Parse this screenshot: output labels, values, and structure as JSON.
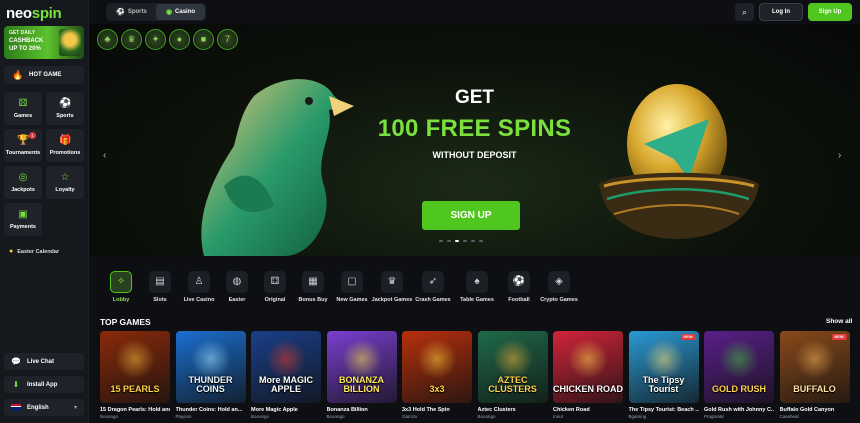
{
  "brand": {
    "logo_text_a": "neo",
    "logo_text_b": "spin"
  },
  "promo": {
    "line1": "GET DAILY",
    "line2": "CASHBACK",
    "line3": "UP TO 20%"
  },
  "sidebar": {
    "hot_game_label": "HOT GAME",
    "items": [
      {
        "label": "Games",
        "icon": "dice-icon"
      },
      {
        "label": "Sports",
        "icon": "soccer-ball-icon"
      },
      {
        "label": "Tournaments",
        "icon": "trophy-icon",
        "badge": "1"
      },
      {
        "label": "Promotions",
        "icon": "gift-icon"
      },
      {
        "label": "Jackpots",
        "icon": "coins-icon"
      },
      {
        "label": "Loyalty",
        "icon": "star-icon"
      },
      {
        "label": "Payments",
        "icon": "wallet-icon"
      }
    ],
    "easter_label": "Easter Calendar",
    "live_chat_label": "Live Chat",
    "install_app_label": "Install App",
    "language_label": "English"
  },
  "topbar": {
    "tab_sports": "Sports",
    "tab_casino": "Casino",
    "active_tab": "Casino",
    "login_label": "Log In",
    "signup_label": "Sign Up"
  },
  "hero": {
    "line1": "GET",
    "line2": "100 FREE SPINS",
    "line3": "WITHOUT DEPOSIT",
    "cta": "SIGN UP",
    "slide_count": 6,
    "active_slide": 3
  },
  "categories": [
    {
      "label": "Lobby",
      "icon": "stars-icon",
      "active": true
    },
    {
      "label": "Slots",
      "icon": "slot-machine-icon"
    },
    {
      "label": "Live Casino",
      "icon": "dealer-icon"
    },
    {
      "label": "Easter",
      "icon": "egg-icon"
    },
    {
      "label": "Original",
      "icon": "dice-icon"
    },
    {
      "label": "Bonus Buy",
      "icon": "gift-box-icon"
    },
    {
      "label": "New Games",
      "icon": "new-card-icon"
    },
    {
      "label": "Jackpot Games",
      "icon": "crown-icon"
    },
    {
      "label": "Crash Games",
      "icon": "rocket-icon"
    },
    {
      "label": "Table Games",
      "icon": "cards-icon"
    },
    {
      "label": "Football",
      "icon": "football-icon"
    },
    {
      "label": "Crypto Games",
      "icon": "crypto-icon"
    }
  ],
  "top_games": {
    "title": "TOP GAMES",
    "show_all": "Show all",
    "items": [
      {
        "name": "15 Dragon Pearls: Hold and...",
        "provider": "Booongo",
        "thumb_text": "15 PEARLS",
        "bg": "#8a2a0a",
        "accent": "#f4b93a",
        "text_color": "#ffd24a"
      },
      {
        "name": "Thunder Coins: Hold an...",
        "provider": "Playson",
        "thumb_text": "THUNDER COINS",
        "bg": "#1b6fd0",
        "accent": "#9fe3ff",
        "text_color": "#e9f7ff"
      },
      {
        "name": "More Magic Apple",
        "provider": "Booongo",
        "thumb_text": "More MAGIC APPLE",
        "bg": "#1a3f8a",
        "accent": "#e23b2b",
        "text_color": "#ffffff"
      },
      {
        "name": "Bonanza Billion",
        "provider": "Booongo",
        "thumb_text": "BONANZA BILLION",
        "bg": "#7a3fd1",
        "accent": "#f5e04a",
        "text_color": "#ffe95a"
      },
      {
        "name": "3x3 Hold The Spin",
        "provider": "Gamzix",
        "thumb_text": "3x3",
        "bg": "#b8300d",
        "accent": "#ffcc3a",
        "text_color": "#ffd84a"
      },
      {
        "name": "Aztec Clusters",
        "provider": "Booongo",
        "thumb_text": "AZTEC CLUSTERS",
        "bg": "#1f6a4a",
        "accent": "#f1b13a",
        "text_color": "#ffd14a"
      },
      {
        "name": "Chicken Road",
        "provider": "Inout",
        "thumb_text": "CHICKEN ROAD",
        "bg": "#d1243a",
        "accent": "#ffd34a",
        "text_color": "#ffffff"
      },
      {
        "name": "The Tipsy Tourist: Beach ...",
        "provider": "Bgaming",
        "thumb_text": "The Tipsy Tourist",
        "bg": "#2a9ad6",
        "accent": "#ffe27a",
        "text_color": "#ffffff",
        "is_new": true,
        "new_label": "NEW"
      },
      {
        "name": "Gold Rush with Johnny C...",
        "provider": "Pragmatic",
        "thumb_text": "GOLD RUSH",
        "bg": "#5a1f8a",
        "accent": "#3fbf3a",
        "text_color": "#ffd24a"
      },
      {
        "name": "Buffalo Gold Canyon",
        "provider": "Casebeat",
        "thumb_text": "BUFFALO",
        "bg": "#8a4a1a",
        "accent": "#f0b25a",
        "text_color": "#ffe0a0",
        "is_new": true,
        "new_label": "NEW"
      }
    ]
  },
  "colors": {
    "accent_green": "#4fc71f",
    "text_green": "#7be03d",
    "sidebar_bg": "#15181d",
    "card_bg": "#1f2329"
  }
}
